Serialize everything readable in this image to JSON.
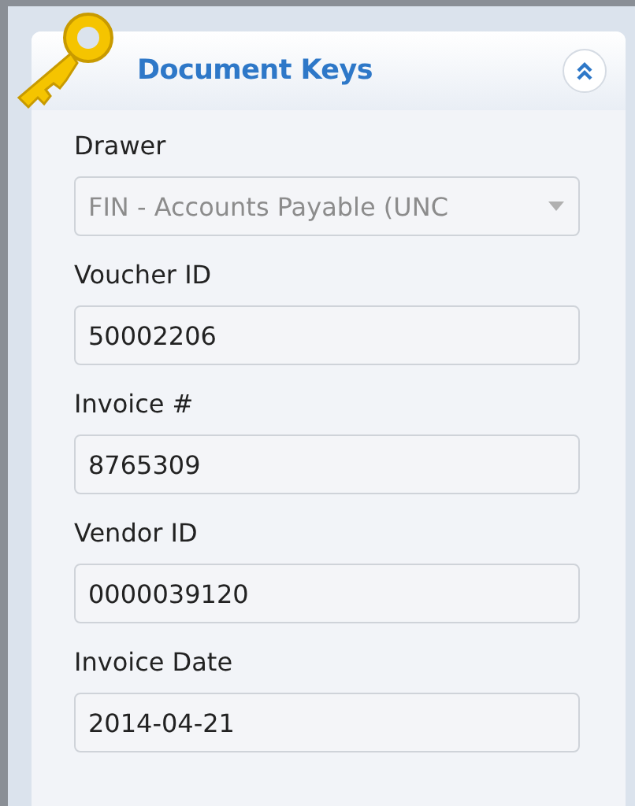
{
  "panel": {
    "title": "Document Keys",
    "expanded": true
  },
  "fields": [
    {
      "kind": "dropdown",
      "label": "Drawer",
      "value": "FIN - Accounts Payable (UNC",
      "disabled": true
    },
    {
      "kind": "text",
      "label": "Voucher ID",
      "value": "50002206",
      "disabled": false
    },
    {
      "kind": "text",
      "label": "Invoice #",
      "value": "8765309",
      "disabled": false
    },
    {
      "kind": "text",
      "label": "Vendor ID",
      "value": "0000039120",
      "disabled": false
    },
    {
      "kind": "text",
      "label": "Invoice Date",
      "value": "2014-04-21",
      "disabled": false
    }
  ]
}
